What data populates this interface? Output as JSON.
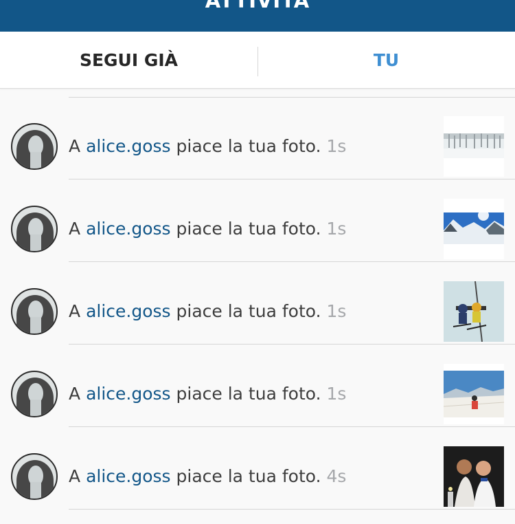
{
  "header": {
    "title": "ATTIVITÀ"
  },
  "tabs": [
    {
      "label": "SEGUI GIÀ"
    },
    {
      "label": "TU"
    }
  ],
  "notifications": [
    {
      "prefix": "A",
      "username": "alice.goss",
      "action": "piace la tua foto.",
      "time": "1s",
      "thumb": "snowy-forest-photo"
    },
    {
      "prefix": "A",
      "username": "alice.goss",
      "action": "piace la tua foto.",
      "time": "1s",
      "thumb": "mountain-sky-photo"
    },
    {
      "prefix": "A",
      "username": "alice.goss",
      "action": "piace la tua foto.",
      "time": "1s",
      "thumb": "chairlift-skiers-photo"
    },
    {
      "prefix": "A",
      "username": "alice.goss",
      "action": "piace la tua foto.",
      "time": "1s",
      "thumb": "ski-slope-photo"
    },
    {
      "prefix": "A",
      "username": "alice.goss",
      "action": "piace la tua foto.",
      "time": "4s",
      "thumb": "party-friends-photo"
    }
  ],
  "colors": {
    "header_bg": "#125688",
    "username": "#125688",
    "active_tab": "#3f8fd2",
    "timestamp": "#a5a7aa"
  }
}
